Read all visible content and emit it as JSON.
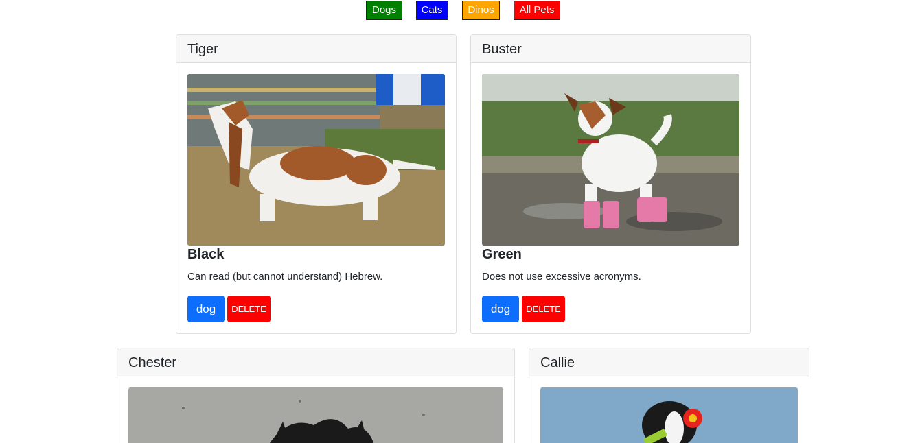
{
  "filters": {
    "dogs": {
      "label": "Dogs",
      "color": "#008000"
    },
    "cats": {
      "label": "Cats",
      "color": "#0000ff"
    },
    "dinos": {
      "label": "Dinos",
      "color": "#ffa500"
    },
    "all": {
      "label": "All Pets",
      "color": "#ff0000"
    }
  },
  "pets": [
    {
      "name": "Tiger",
      "color": "Black",
      "description": "Can read (but cannot understand) Hebrew.",
      "type": "dog",
      "delete_label": "DELETE"
    },
    {
      "name": "Buster",
      "color": "Green",
      "description": "Does not use excessive acronyms.",
      "type": "dog",
      "delete_label": "DELETE"
    },
    {
      "name": "Chester"
    },
    {
      "name": "Callie"
    }
  ],
  "colors": {
    "type_button": "#0d6efd",
    "delete_button": "#ff0000"
  }
}
